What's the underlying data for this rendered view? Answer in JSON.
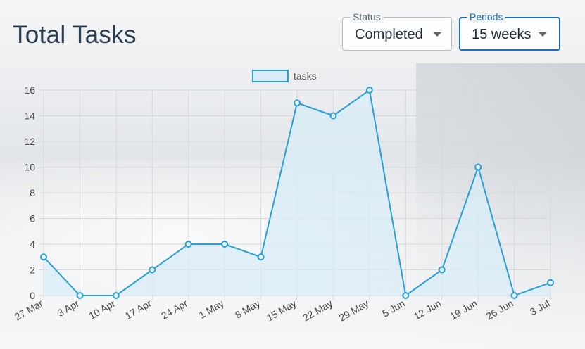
{
  "header": {
    "title": "Total Tasks"
  },
  "filters": {
    "status": {
      "label": "Status",
      "value": "Completed"
    },
    "periods": {
      "label": "Periods",
      "value": "15 weeks"
    }
  },
  "colors": {
    "line": "#2b9fd4",
    "fill": "#d8ecf7",
    "grid": "#d6d8da",
    "text": "#444444"
  },
  "icons": {
    "dropdown": "caret-down-icon"
  },
  "chart_data": {
    "type": "area",
    "categories": [
      "27 Mar",
      "3 Apr",
      "10 Apr",
      "17 Apr",
      "24 Apr",
      "1 May",
      "8 May",
      "15 May",
      "22 May",
      "29 May",
      "5 Jun",
      "12 Jun",
      "19 Jun",
      "26 Jun",
      "3 Jul"
    ],
    "series": [
      {
        "name": "tasks",
        "values": [
          3,
          0,
          0,
          2,
          4,
          4,
          3,
          15,
          14,
          16,
          0,
          2,
          10,
          0,
          1
        ]
      }
    ],
    "ylim": [
      0,
      16
    ],
    "yticks": [
      "0",
      "2",
      "4",
      "6",
      "8",
      "10",
      "12",
      "14",
      "16"
    ],
    "grid": true,
    "legend": "top-center"
  }
}
